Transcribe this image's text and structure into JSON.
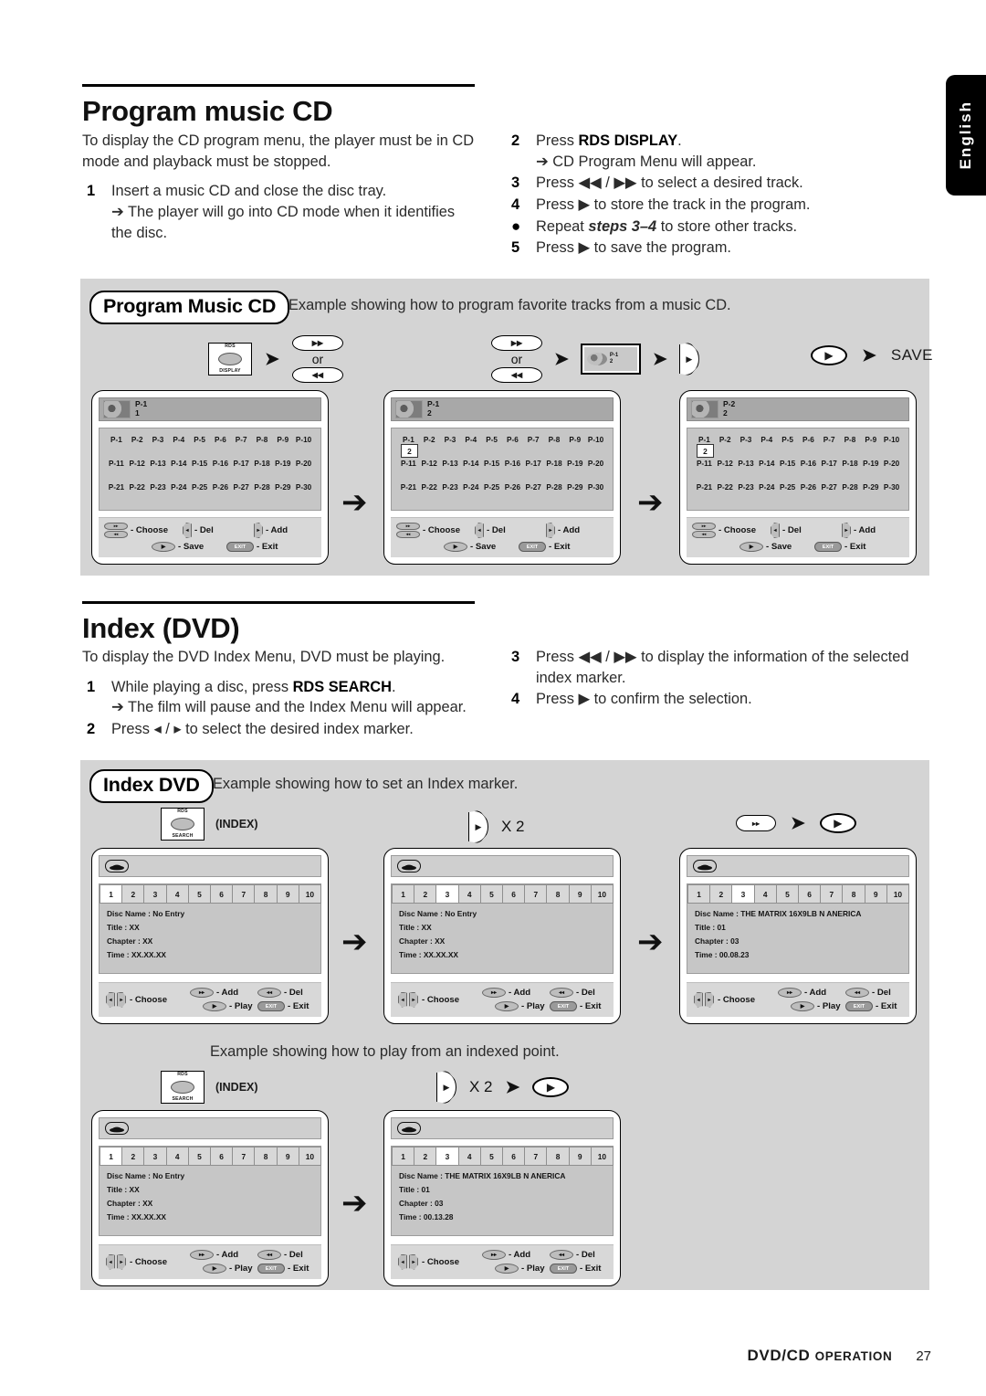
{
  "language_tab": "English",
  "footer": {
    "section": "DVD/CD",
    "section_small": "OPERATION",
    "page": "27"
  },
  "section1": {
    "title": "Program music CD",
    "intro": "To display the CD program menu, the player must be in CD mode and playback must be stopped.",
    "left_steps": [
      {
        "n": "1",
        "text": "Insert a music CD and close the disc tray.",
        "sub": "➔ The player will go into CD mode when it identifies the disc."
      }
    ],
    "right_steps": [
      {
        "n": "2",
        "text": "Press RDS DISPLAY.",
        "bold": "RDS DISPLAY",
        "sub": "➔ CD Program Menu will appear."
      },
      {
        "n": "3",
        "text": "Press ◀◀ / ▶▶ to select a desired track."
      },
      {
        "n": "4",
        "text": "Press ▶ to store the track in the program."
      },
      {
        "n": "●",
        "text": "Repeat steps 3–4 to store other tracks.",
        "italic": "steps 3–4"
      },
      {
        "n": "5",
        "text": "Press ▶ to save the program."
      }
    ],
    "panel": {
      "badge": "Program Music CD",
      "caption": "Example showing how to program favorite tracks from a music CD.",
      "flow": {
        "key_rds_top": "RDS",
        "key_rds_bottom": "DISPLAY",
        "rocker_up": "▶▶",
        "rocker_down": "◀◀",
        "or": "or",
        "save_label": "SAVE"
      }
    }
  },
  "cd_screens": [
    {
      "header_line1": "P-1",
      "header_line2": "1",
      "selected_cell": null,
      "selected_value": null,
      "rows": [
        [
          "P-1",
          "P-2",
          "P-3",
          "P-4",
          "P-5",
          "P-6",
          "P-7",
          "P-8",
          "P-9",
          "P-10"
        ],
        [
          "P-11",
          "P-12",
          "P-13",
          "P-14",
          "P-15",
          "P-16",
          "P-17",
          "P-18",
          "P-19",
          "P-20"
        ],
        [
          "P-21",
          "P-22",
          "P-23",
          "P-24",
          "P-25",
          "P-26",
          "P-27",
          "P-28",
          "P-29",
          "P-30"
        ]
      ]
    },
    {
      "header_line1": "P-1",
      "header_line2": "2",
      "selected_cell": 0,
      "selected_value": "2",
      "rows": [
        [
          "P-1",
          "P-2",
          "P-3",
          "P-4",
          "P-5",
          "P-6",
          "P-7",
          "P-8",
          "P-9",
          "P-10"
        ],
        [
          "P-11",
          "P-12",
          "P-13",
          "P-14",
          "P-15",
          "P-16",
          "P-17",
          "P-18",
          "P-19",
          "P-20"
        ],
        [
          "P-21",
          "P-22",
          "P-23",
          "P-24",
          "P-25",
          "P-26",
          "P-27",
          "P-28",
          "P-29",
          "P-30"
        ]
      ]
    },
    {
      "header_line1": "P-2",
      "header_line2": "2",
      "selected_cell": 0,
      "selected_value": "2",
      "rows": [
        [
          "P-1",
          "P-2",
          "P-3",
          "P-4",
          "P-5",
          "P-6",
          "P-7",
          "P-8",
          "P-9",
          "P-10"
        ],
        [
          "P-11",
          "P-12",
          "P-13",
          "P-14",
          "P-15",
          "P-16",
          "P-17",
          "P-18",
          "P-19",
          "P-20"
        ],
        [
          "P-21",
          "P-22",
          "P-23",
          "P-24",
          "P-25",
          "P-26",
          "P-27",
          "P-28",
          "P-29",
          "P-30"
        ]
      ]
    }
  ],
  "cd_legend": {
    "choose": "- Choose",
    "del": "- Del",
    "add": "- Add",
    "save": "- Save",
    "exit": "- Exit",
    "exit_key": "EXIT"
  },
  "section2": {
    "title": "Index (DVD)",
    "intro": "To display the DVD Index Menu, DVD must be playing.",
    "left_steps": [
      {
        "n": "1",
        "text": "While playing a disc, press RDS SEARCH.",
        "bold": "RDS SEARCH",
        "sub": "➔ The film will pause and the Index Menu will appear."
      },
      {
        "n": "2",
        "text": "Press ◂ / ▸ to select the desired index marker."
      }
    ],
    "right_steps": [
      {
        "n": "3",
        "text": "Press ◀◀ / ▶▶ to display the information of the selected index marker."
      },
      {
        "n": "4",
        "text": "Press ▶ to confirm the selection."
      }
    ],
    "panel": {
      "badge": "Index DVD",
      "caption_top": "Example showing how to set an Index marker.",
      "caption_bottom": "Example showing how to play from an indexed point.",
      "key_rds_top": "RDS",
      "key_rds_bottom": "SEARCH",
      "index_label": "(INDEX)",
      "x2": "X 2"
    }
  },
  "dvd_legend": {
    "choose": "- Choose",
    "add": "- Add",
    "del": "- Del",
    "play": "- Play",
    "exit": "- Exit",
    "exit_key": "EXIT"
  },
  "dvd_screens_top": [
    {
      "tabs": [
        "1",
        "2",
        "3",
        "4",
        "5",
        "6",
        "7",
        "8",
        "9",
        "10"
      ],
      "active_tab": 0,
      "disc_name": "Disc Name : No Entry",
      "title": "Title : XX",
      "chapter": "Chapter : XX",
      "time": "Time : XX.XX.XX"
    },
    {
      "tabs": [
        "1",
        "2",
        "3",
        "4",
        "5",
        "6",
        "7",
        "8",
        "9",
        "10"
      ],
      "active_tab": 2,
      "disc_name": "Disc Name : No Entry",
      "title": "Title : XX",
      "chapter": "Chapter : XX",
      "time": "Time : XX.XX.XX"
    },
    {
      "tabs": [
        "1",
        "2",
        "3",
        "4",
        "5",
        "6",
        "7",
        "8",
        "9",
        "10"
      ],
      "active_tab": 2,
      "disc_name": "Disc Name : THE MATRIX 16X9LB N ANERICA",
      "title": "Title : 01",
      "chapter": "Chapter : 03",
      "time": "Time : 00.08.23"
    }
  ],
  "dvd_screens_bottom": [
    {
      "tabs": [
        "1",
        "2",
        "3",
        "4",
        "5",
        "6",
        "7",
        "8",
        "9",
        "10"
      ],
      "active_tab": 0,
      "disc_name": "Disc Name : No Entry",
      "title": "Title : XX",
      "chapter": "Chapter : XX",
      "time": "Time : XX.XX.XX"
    },
    {
      "tabs": [
        "1",
        "2",
        "3",
        "4",
        "5",
        "6",
        "7",
        "8",
        "9",
        "10"
      ],
      "active_tab": 2,
      "disc_name": "Disc Name : THE MATRIX 16X9LB N ANERICA",
      "title": "Title : 01",
      "chapter": "Chapter : 03",
      "time": "Time : 00.13.28"
    }
  ]
}
